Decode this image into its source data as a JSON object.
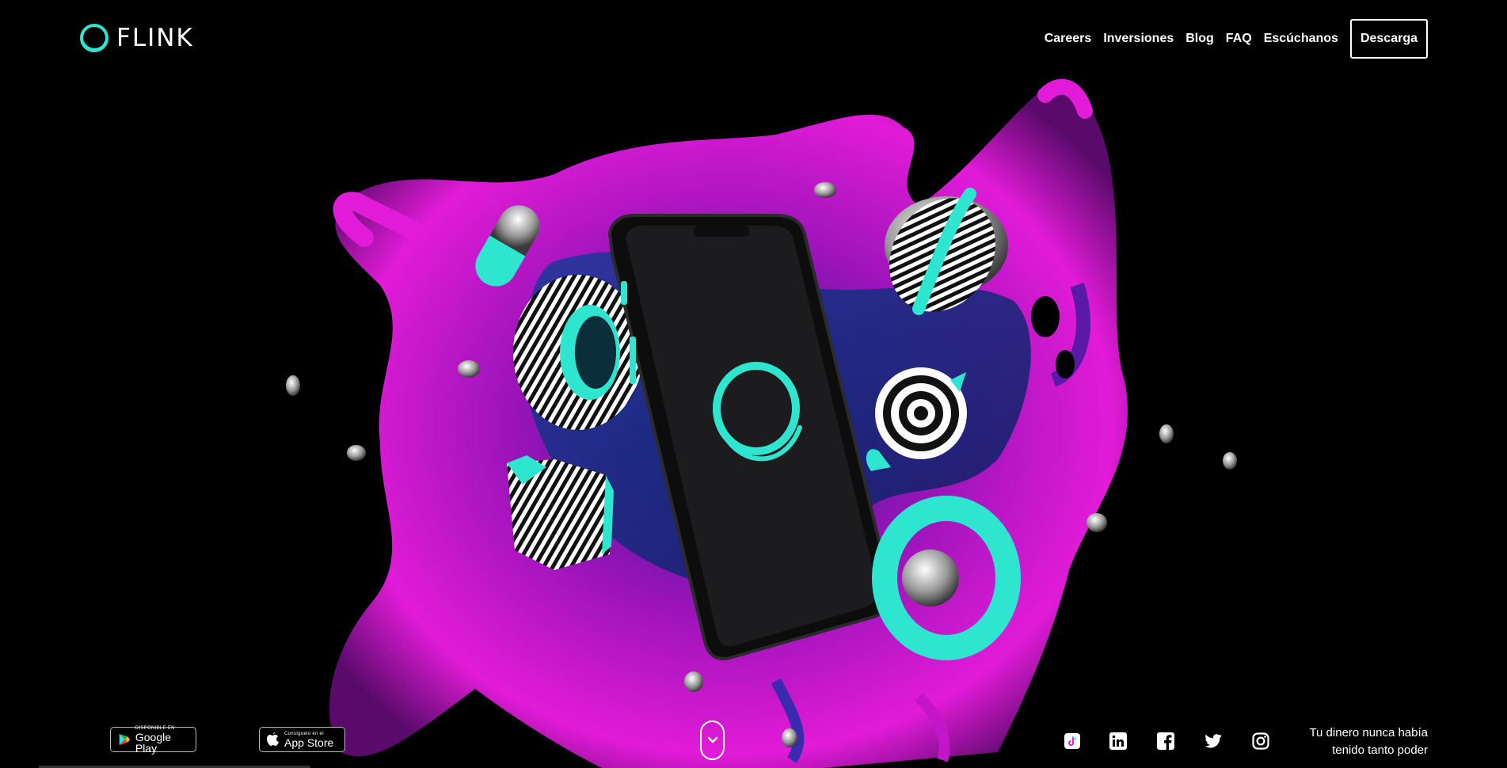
{
  "brand": {
    "name": "FLINK",
    "accent": "#2ee6cf",
    "magenta": "#e21bd8"
  },
  "nav": {
    "items": [
      "Careers",
      "Inversiones",
      "Blog",
      "FAQ",
      "Escúchanos"
    ],
    "cta": "Descarga"
  },
  "hero": {
    "image_description_icon": "phone-with-3d-shapes"
  },
  "footer": {
    "google_play": {
      "small": "DISPONIBLE EN",
      "big": "Google Play"
    },
    "app_store": {
      "small": "Consíguelo en el",
      "big": "App Store"
    },
    "scroll_icon": "chevron-down-icon",
    "social_icons": [
      "tiktok-icon",
      "linkedin-icon",
      "facebook-icon",
      "twitter-icon",
      "instagram-icon"
    ],
    "tagline_line1": "Tu dinero nunca había",
    "tagline_line2": "tenido tanto poder"
  }
}
